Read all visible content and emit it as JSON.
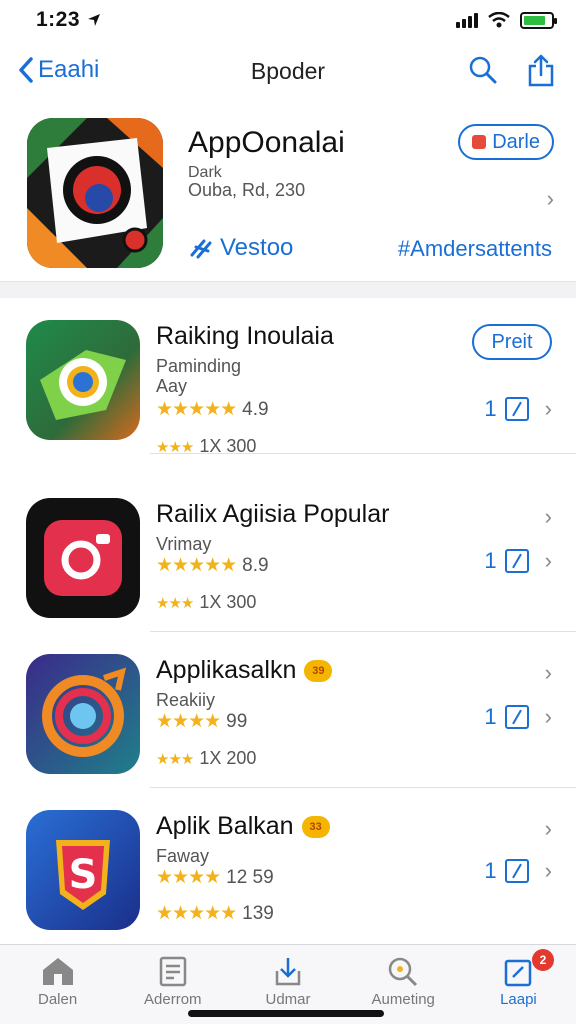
{
  "status": {
    "time": "1:23"
  },
  "nav": {
    "back_label": "Eaahi",
    "title": "Bpoder"
  },
  "featured": {
    "title": "AppOonalai",
    "sub1": "Dark",
    "sub2": "Ouba, Rd, 230",
    "get_label": "Darle",
    "link_left": "Vestoo",
    "link_right": "#Amdersattents"
  },
  "rows": [
    {
      "title": "Raiking Inoulaia",
      "sub1": "Paminding",
      "sub2": "Aay",
      "rating": "4.9",
      "reviews": "1X 300",
      "count": "1",
      "get_label": "Preit"
    },
    {
      "title": "Railix Agiisia Popular",
      "sub1": "Vrimay",
      "rating": "8.9",
      "reviews": "1X 300",
      "count": "1"
    },
    {
      "title": "Applikasalkn",
      "badge": "39",
      "sub1": "Reakiiy",
      "rating": "99",
      "reviews": "1X 200",
      "count": "1"
    },
    {
      "title": "Aplik Balkan",
      "badge": "33",
      "sub1": "Faway",
      "rating": "12 59",
      "reviews": "139",
      "count": "1"
    }
  ],
  "tabs": [
    {
      "label": "Dalen",
      "icon": "home-icon"
    },
    {
      "label": "Aderrom",
      "icon": "document-icon"
    },
    {
      "label": "Udmar",
      "icon": "download-icon"
    },
    {
      "label": "Aumeting",
      "icon": "search-icon"
    },
    {
      "label": "Laapi",
      "icon": "update-icon",
      "badge": "2"
    }
  ],
  "colors": {
    "accent": "#1a6fd6",
    "star": "#f2b21b",
    "badge_red": "#e23a2e"
  }
}
